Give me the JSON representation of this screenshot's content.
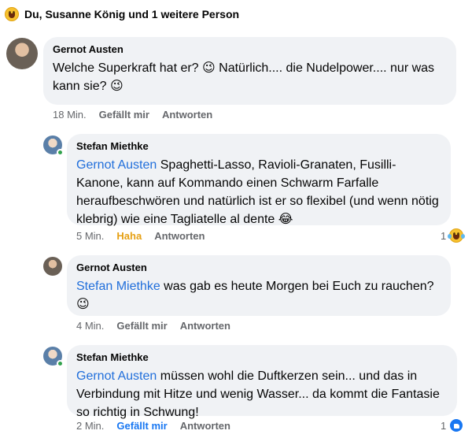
{
  "reactions_header": {
    "text": "Du, Susanne König und 1 weitere Person",
    "icon": "laughing-emoji-icon"
  },
  "comments": [
    {
      "author": "Gernot Austen",
      "text": "Welche Superkraft hat er? 😉 Natürlich.... die Nudelpower.... nur was kann sie? 😉",
      "time": "18 Min.",
      "like_label": "Gefällt mir",
      "reply_label": "Antworten"
    },
    {
      "author": "Stefan Miethke",
      "mention": "Gernot Austen",
      "text": " Spaghetti-Lasso, Ravioli-Granaten, Fusilli-Kanone, kann auf Kommando einen Schwarm Farfalle heraufbeschwören und natürlich ist er so flexibel (und wenn nötig klebrig) wie eine Tagliatelle al dente 😂",
      "time": "5 Min.",
      "like_label": "Haha",
      "reply_label": "Antworten",
      "reaction_count": "1",
      "reaction_icon": "laughing-emoji-icon"
    },
    {
      "author": "Gernot Austen",
      "mention": "Stefan Miethke",
      "text": " was gab es heute Morgen bei Euch zu rauchen? 😉",
      "time": "4 Min.",
      "like_label": "Gefällt mir",
      "reply_label": "Antworten"
    },
    {
      "author": "Stefan Miethke",
      "mention": "Gernot Austen",
      "text": " müssen wohl die Duftkerzen sein... und das in Verbindung mit Hitze und wenig Wasser... da kommt die Fantasie so richtig in Schwung!",
      "time": "2 Min.",
      "like_label": "Gefällt mir",
      "reply_label": "Antworten",
      "reaction_count": "1",
      "reaction_icon": "like-icon"
    }
  ],
  "colors": {
    "mention": "#216fdb",
    "haha": "#e6a014",
    "liked": "#1877f2",
    "bubble": "#f0f2f5",
    "meta": "#65676b"
  }
}
